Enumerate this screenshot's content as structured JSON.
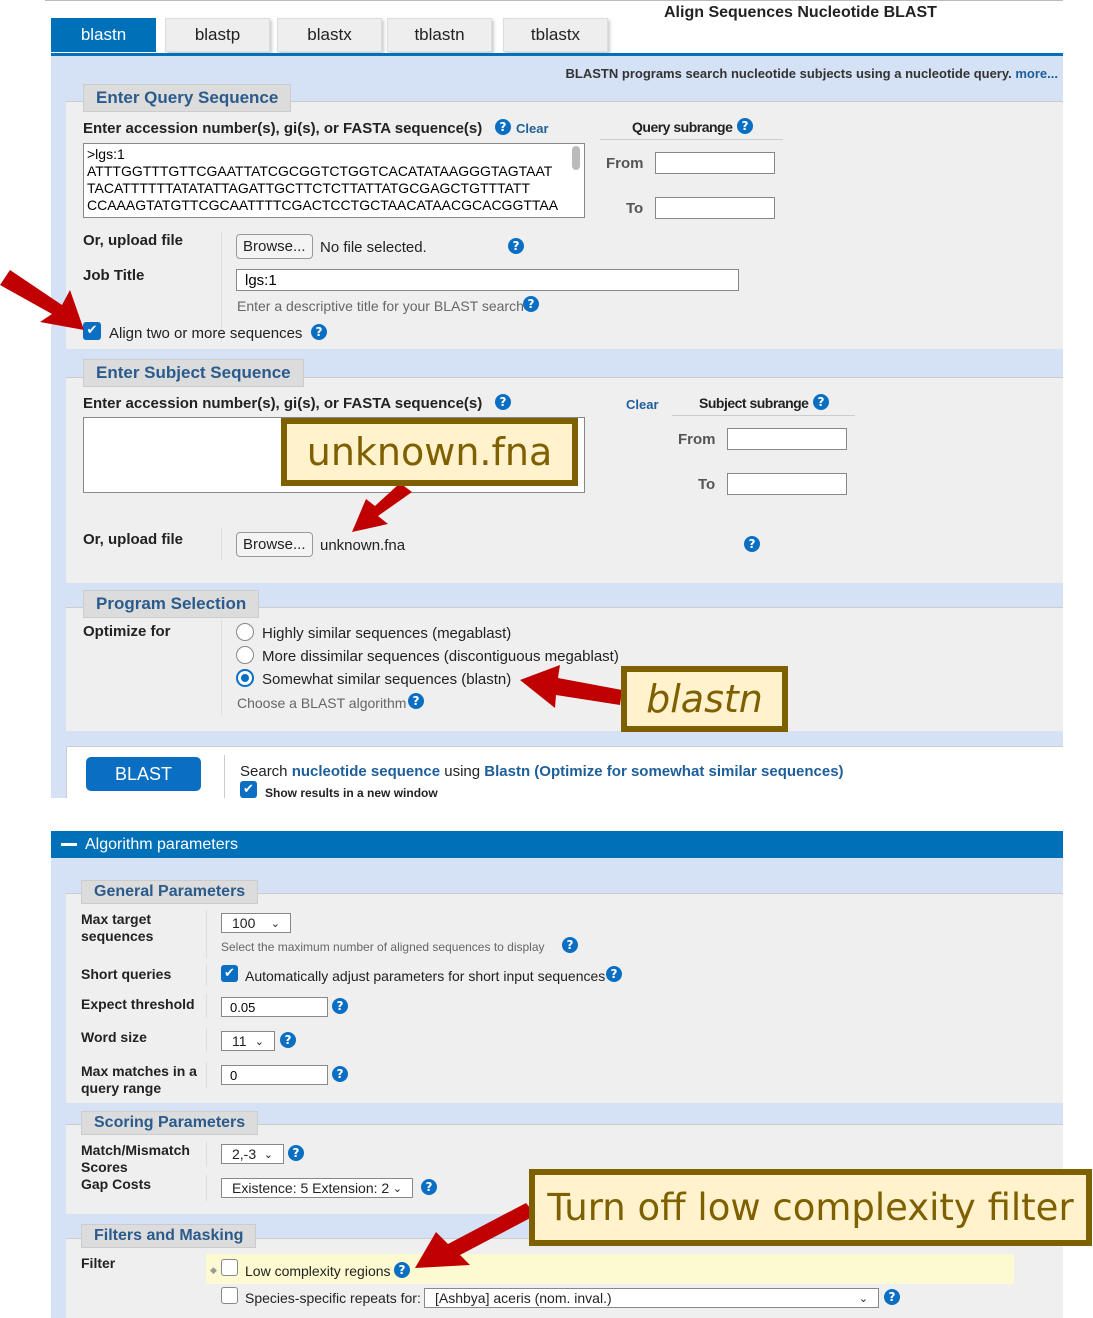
{
  "header": {
    "title": "Align Sequences Nucleotide BLAST",
    "tabs": [
      {
        "label": "blastn",
        "active": true
      },
      {
        "label": "blastp",
        "active": false
      },
      {
        "label": "blastx",
        "active": false
      },
      {
        "label": "tblastn",
        "active": false
      },
      {
        "label": "tblastx",
        "active": false
      }
    ],
    "description": "BLASTN programs search nucleotide subjects using a nucleotide query.",
    "more_link": "more..."
  },
  "query": {
    "legend": "Enter Query Sequence",
    "label": "Enter accession number(s), gi(s), or FASTA sequence(s)",
    "clear": "Clear",
    "sequence": ">lgs:1\nATTTGGTTTGTTCGAATTATCGCGGTCTGGTCACATATAAGGGTAGTAAT\nTACATTTTTTATATATTAGATTGCTTCTCTTATTATGCGAGCTGTTTATT\nCCAAAGTATGTTCGCAATTTTCGACTCCTGCTAACATAACGCACGGTTAA",
    "subrange_title": "Query subrange",
    "from_label": "From",
    "to_label": "To",
    "from_value": "",
    "to_value": "",
    "upload_label": "Or, upload file",
    "browse_label": "Browse...",
    "file_status": "No file selected.",
    "job_title_label": "Job Title",
    "job_title_value": "lgs:1",
    "job_title_hint": "Enter a descriptive title for your BLAST search",
    "align_two_label": "Align two or more sequences",
    "align_two_checked": true
  },
  "subject": {
    "legend": "Enter Subject Sequence",
    "label": "Enter accession number(s), gi(s), or FASTA sequence(s)",
    "clear": "Clear",
    "sequence": "",
    "subrange_title": "Subject subrange",
    "from_label": "From",
    "to_label": "To",
    "from_value": "",
    "to_value": "",
    "upload_label": "Or, upload file",
    "browse_label": "Browse...",
    "file_status": "unknown.fna"
  },
  "program": {
    "legend": "Program Selection",
    "label": "Optimize for",
    "options": [
      {
        "label": "Highly similar sequences (megablast)",
        "selected": false
      },
      {
        "label": "More dissimilar sequences (discontiguous megablast)",
        "selected": false
      },
      {
        "label": "Somewhat similar sequences (blastn)",
        "selected": true
      }
    ],
    "hint": "Choose a BLAST algorithm"
  },
  "submit": {
    "button": "BLAST",
    "summary_prefix": "Search",
    "summary_db": "nucleotide sequence",
    "summary_mid": "using",
    "summary_program": "Blastn (Optimize for somewhat similar sequences)",
    "new_window_label": "Show results in a new window",
    "new_window_checked": true
  },
  "algorithm": {
    "header": "Algorithm parameters",
    "toggle_icon": "minus-icon",
    "general": {
      "legend": "General Parameters",
      "max_target_label": "Max target sequences",
      "max_target_value": "100",
      "max_target_hint": "Select the maximum number of aligned sequences to display",
      "short_queries_label": "Short queries",
      "short_queries_text": "Automatically adjust parameters for short input sequences",
      "short_queries_checked": true,
      "expect_label": "Expect threshold",
      "expect_value": "0.05",
      "word_size_label": "Word size",
      "word_size_value": "11",
      "max_matches_label": "Max matches in a query range",
      "max_matches_value": "0"
    },
    "scoring": {
      "legend": "Scoring Parameters",
      "match_label": "Match/Mismatch Scores",
      "match_value": "2,-3",
      "gap_label": "Gap Costs",
      "gap_value": "Existence: 5 Extension: 2"
    },
    "filters": {
      "legend": "Filters and Masking",
      "filter_label": "Filter",
      "low_complexity_label": "Low complexity regions",
      "low_complexity_checked": false,
      "species_label": "Species-specific repeats for:",
      "species_checked": false,
      "species_value": "[Ashbya] aceris (nom. inval.)"
    }
  },
  "annotations": {
    "subject_callout": "unknown.fna",
    "program_callout": "blastn",
    "filter_callout": "Turn off low complexity filter",
    "arrow_color": "#c00000",
    "callout_border": "#7f6000",
    "callout_bg": "#fff2cc"
  }
}
